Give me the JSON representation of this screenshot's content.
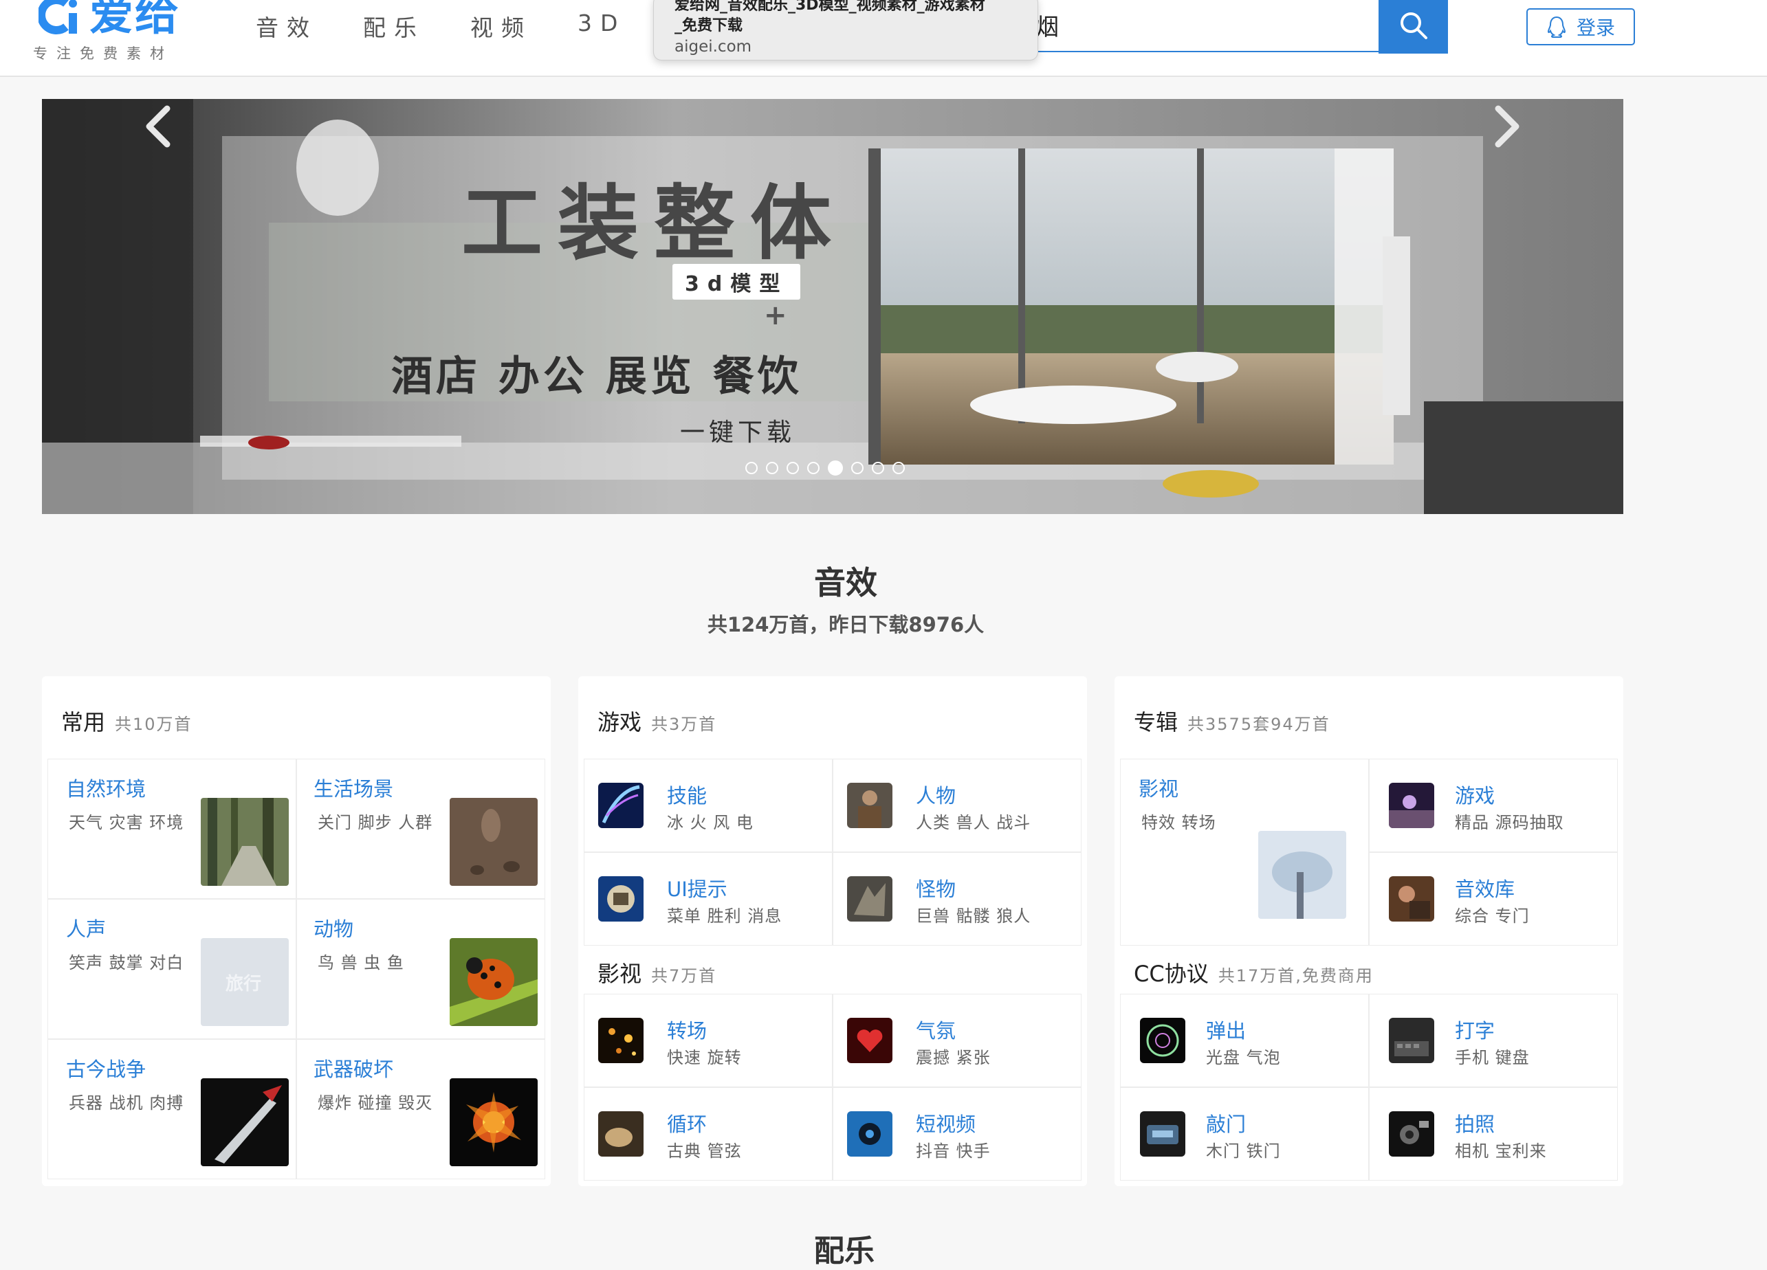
{
  "header": {
    "logo_text": "爱给",
    "slogan": "专注免费素材",
    "nav": [
      "音效",
      "配乐",
      "视频",
      "3D"
    ],
    "search_value": "烟",
    "login_label": "登录",
    "tooltip": {
      "title_line1": "爱给网_音效配乐_3D模型_视频素材_游戏素材",
      "title_line2": "_免费下载",
      "url": "aigei.com"
    }
  },
  "banner": {
    "title": "工装整体",
    "tag": "3d模型",
    "plus": "+",
    "subtitle": "酒店 办公 展览 餐饮",
    "cta": "一键下载",
    "slide_count": 8,
    "active_slide": 5
  },
  "section": {
    "title": "音效",
    "subtitle": "共124万首，昨日下载8976人"
  },
  "cards": {
    "common": {
      "title": "常用",
      "count": "共10万首",
      "items": [
        {
          "title": "自然环境",
          "tags": "天气 灾害 环境"
        },
        {
          "title": "生活场景",
          "tags": "关门 脚步 人群"
        },
        {
          "title": "人声",
          "tags": "笑声 鼓掌 对白"
        },
        {
          "title": "动物",
          "tags": "鸟 兽 虫 鱼"
        },
        {
          "title": "古今战争",
          "tags": "兵器 战机 肉搏"
        },
        {
          "title": "武器破坏",
          "tags": "爆炸 碰撞 毁灭"
        }
      ],
      "thumb_text": "旅行"
    },
    "game": {
      "title": "游戏",
      "count": "共3万首",
      "items": [
        {
          "title": "技能",
          "tags": "冰 火 风 电"
        },
        {
          "title": "人物",
          "tags": "人类 兽人 战斗"
        },
        {
          "title": "UI提示",
          "tags": "菜单 胜利 消息"
        },
        {
          "title": "怪物",
          "tags": "巨兽 骷髅 狼人"
        }
      ]
    },
    "film": {
      "title": "影视",
      "count": "共7万首",
      "items": [
        {
          "title": "转场",
          "tags": "快速 旋转"
        },
        {
          "title": "气氛",
          "tags": "震撼 紧张"
        },
        {
          "title": "循环",
          "tags": "古典 管弦"
        },
        {
          "title": "短视频",
          "tags": "抖音 快手"
        }
      ]
    },
    "album": {
      "title": "专辑",
      "count": "共3575套94万首",
      "items": [
        {
          "title": "影视",
          "tags": "特效 转场"
        },
        {
          "title": "游戏",
          "tags": "精品 源码抽取"
        },
        {
          "title": "音效库",
          "tags": "综合 专门"
        }
      ]
    },
    "cc": {
      "title": "CC协议",
      "count": "共17万首,免费商用",
      "items": [
        {
          "title": "弹出",
          "tags": "光盘 气泡"
        },
        {
          "title": "打字",
          "tags": "手机 键盘"
        },
        {
          "title": "敲门",
          "tags": "木门 铁门"
        },
        {
          "title": "拍照",
          "tags": "相机 宝利来"
        }
      ]
    }
  },
  "next_section_title": "配乐",
  "colors": {
    "accent": "#2b7fd6",
    "brand": "#2b8cf0"
  }
}
